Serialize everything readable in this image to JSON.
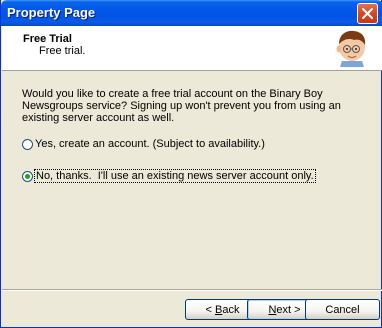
{
  "window": {
    "title": "Property Page"
  },
  "header": {
    "title": "Free Trial",
    "subtitle": "Free trial."
  },
  "main": {
    "description": "Would you like to create a free trial account on the Binary Boy Newsgroups service? Signing up won't prevent you from using an existing server account as well.",
    "options": [
      {
        "label": "Yes, create an account. (Subject to availability.)",
        "checked": false
      },
      {
        "label": "No, thanks.  I'll use an existing news server account only.",
        "checked": true
      }
    ]
  },
  "footer": {
    "back": {
      "prefix": "< ",
      "access": "B",
      "rest": "ack"
    },
    "next": {
      "access": "N",
      "rest": "ext >"
    },
    "cancel": "Cancel"
  },
  "colors": {
    "titlebar": "#0054E3",
    "dialog_bg": "#ECE9D8",
    "close": "#D8481F",
    "radio_dot": "#21A121"
  },
  "icons": {
    "close": "close-icon",
    "avatar": "cartoon-boy-avatar"
  }
}
